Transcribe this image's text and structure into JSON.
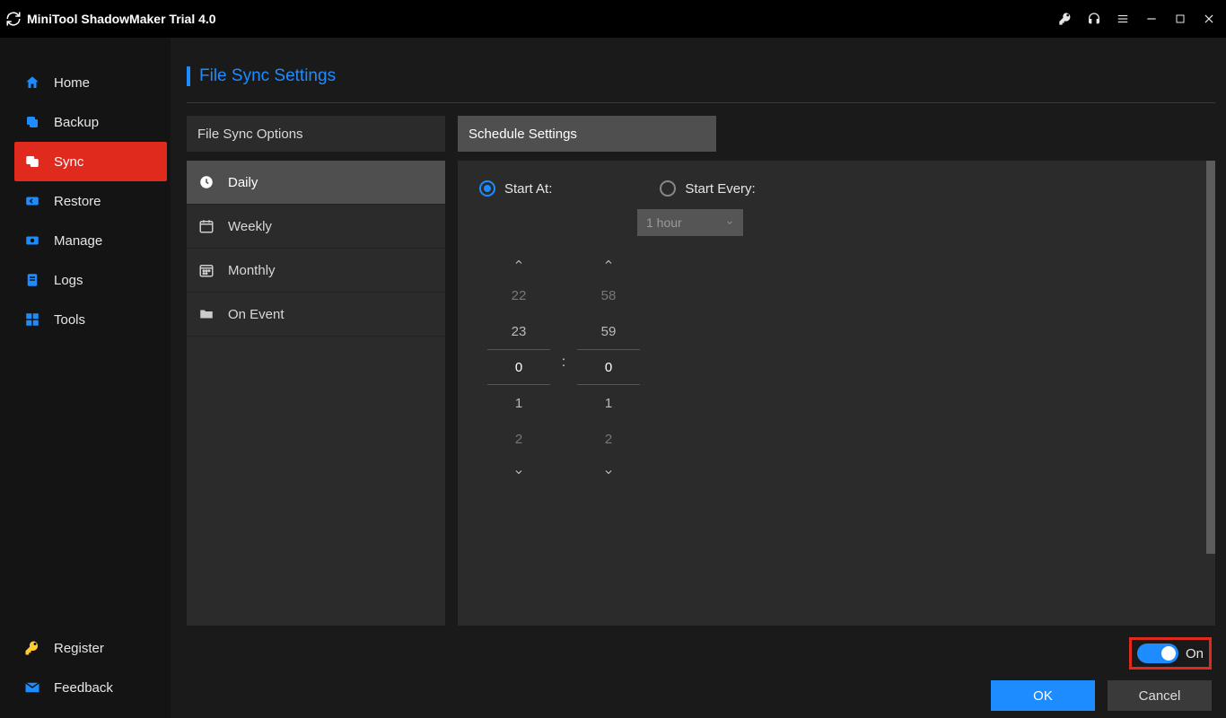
{
  "app": {
    "title": "MiniTool ShadowMaker Trial 4.0"
  },
  "sidebar": {
    "items": [
      {
        "label": "Home"
      },
      {
        "label": "Backup"
      },
      {
        "label": "Sync"
      },
      {
        "label": "Restore"
      },
      {
        "label": "Manage"
      },
      {
        "label": "Logs"
      },
      {
        "label": "Tools"
      }
    ],
    "bottom": {
      "register": "Register",
      "feedback": "Feedback"
    }
  },
  "page": {
    "title": "File Sync Settings"
  },
  "tabs": {
    "options": "File Sync Options",
    "schedule": "Schedule Settings"
  },
  "schedule_types": {
    "daily": "Daily",
    "weekly": "Weekly",
    "monthly": "Monthly",
    "onevent": "On Event"
  },
  "daily": {
    "start_at_label": "Start At:",
    "start_every_label": "Start Every:",
    "interval_selected": "1 hour",
    "hours": {
      "minus2": "22",
      "minus1": "23",
      "selected": "0",
      "plus1": "1",
      "plus2": "2"
    },
    "minutes": {
      "minus2": "58",
      "minus1": "59",
      "selected": "0",
      "plus1": "1",
      "plus2": "2"
    },
    "colon": ":"
  },
  "footer": {
    "on_label": "On",
    "ok": "OK",
    "cancel": "Cancel"
  }
}
